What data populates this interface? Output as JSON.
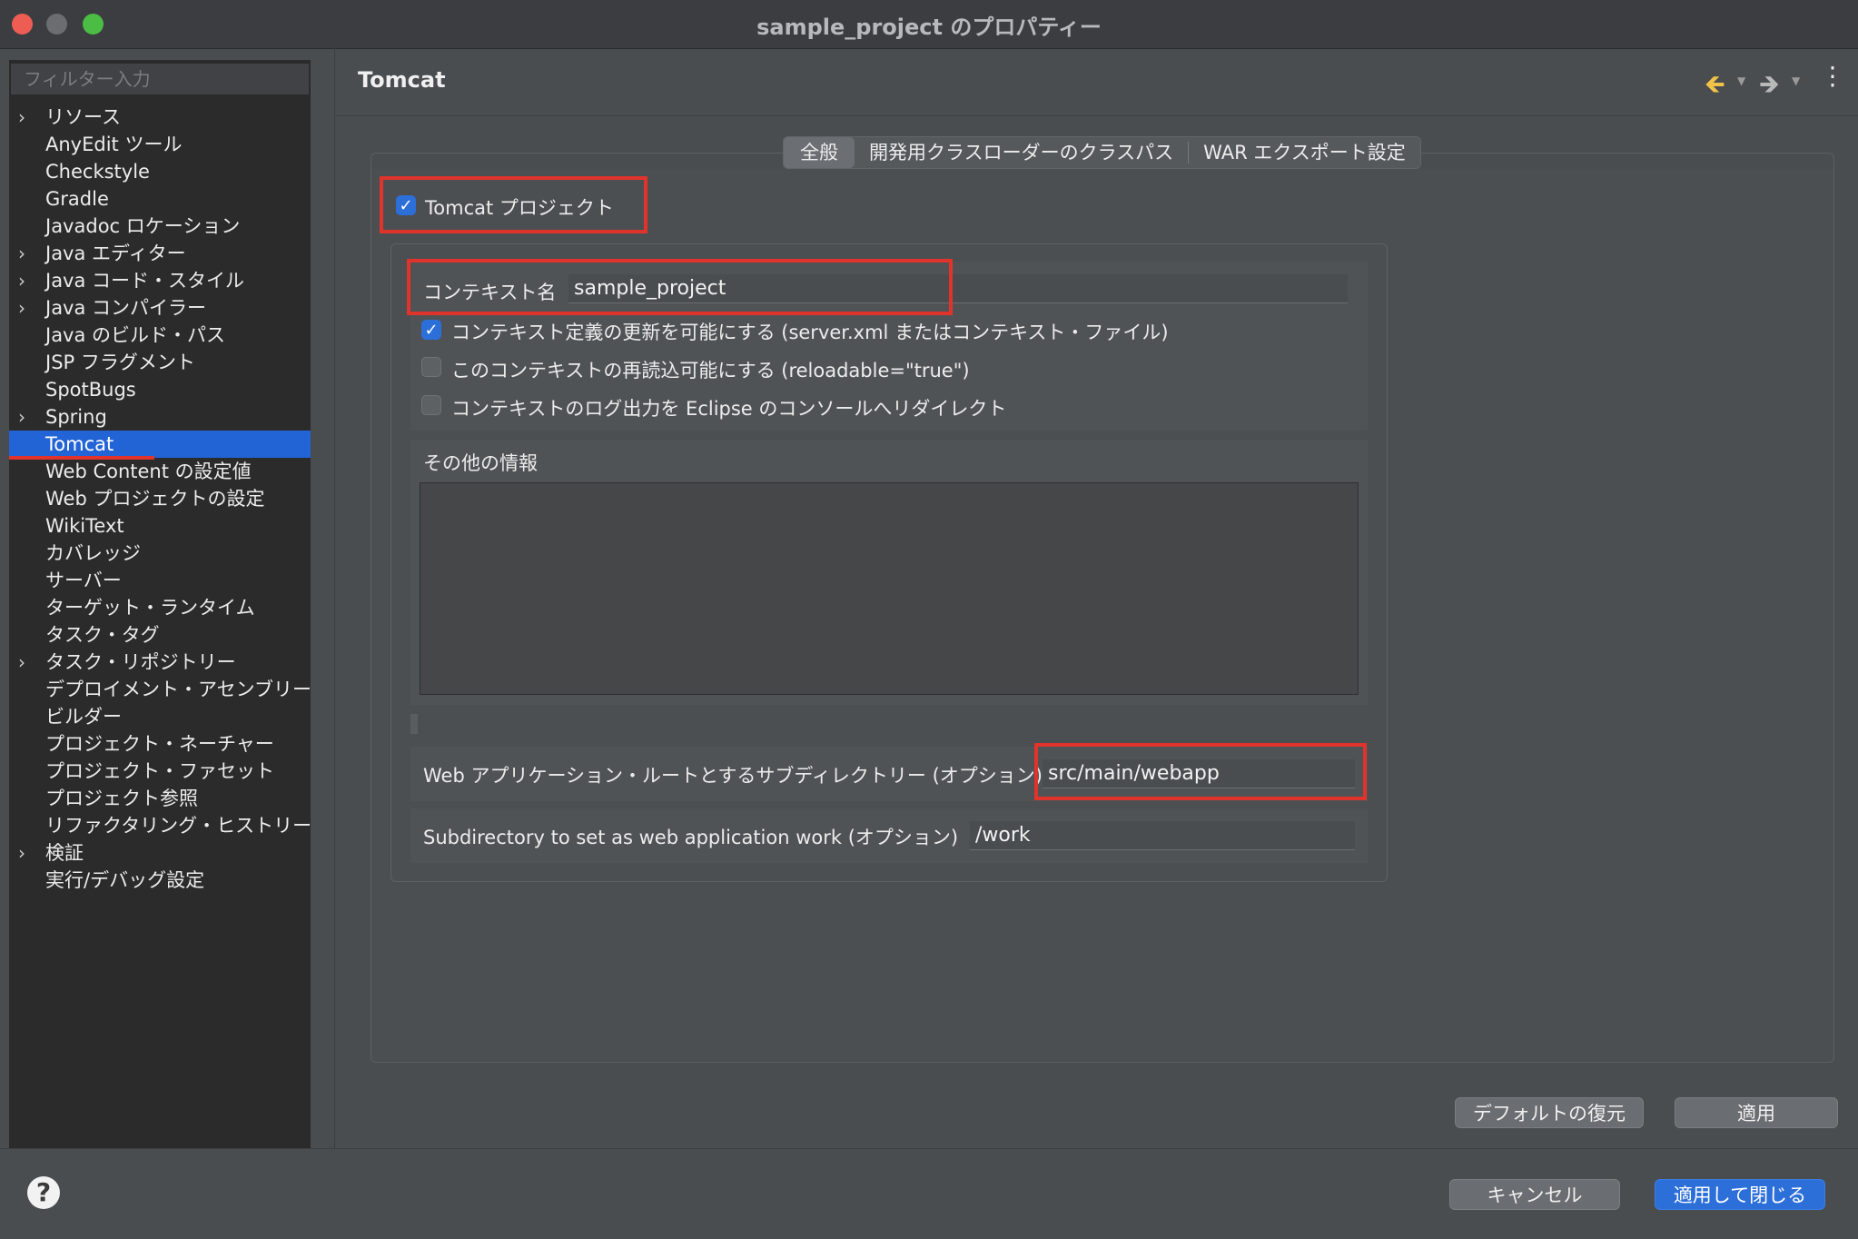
{
  "window": {
    "title": "sample_project のプロパティー"
  },
  "sidebar": {
    "filter_placeholder": "フィルター入力",
    "items": [
      {
        "label": "リソース",
        "expandable": true
      },
      {
        "label": "AnyEdit ツール",
        "expandable": false
      },
      {
        "label": "Checkstyle",
        "expandable": false
      },
      {
        "label": "Gradle",
        "expandable": false
      },
      {
        "label": "Javadoc ロケーション",
        "expandable": false
      },
      {
        "label": "Java エディター",
        "expandable": true
      },
      {
        "label": "Java コード・スタイル",
        "expandable": true
      },
      {
        "label": "Java コンパイラー",
        "expandable": true
      },
      {
        "label": "Java のビルド・パス",
        "expandable": false
      },
      {
        "label": "JSP フラグメント",
        "expandable": false
      },
      {
        "label": "SpotBugs",
        "expandable": false
      },
      {
        "label": "Spring",
        "expandable": true
      },
      {
        "label": "Tomcat",
        "expandable": false,
        "selected": true
      },
      {
        "label": "Web Content の設定値",
        "expandable": false
      },
      {
        "label": "Web プロジェクトの設定",
        "expandable": false
      },
      {
        "label": "WikiText",
        "expandable": false
      },
      {
        "label": "カバレッジ",
        "expandable": false
      },
      {
        "label": "サーバー",
        "expandable": false
      },
      {
        "label": "ターゲット・ランタイム",
        "expandable": false
      },
      {
        "label": "タスク・タグ",
        "expandable": false
      },
      {
        "label": "タスク・リポジトリー",
        "expandable": true
      },
      {
        "label": "デプロイメント・アセンブリー",
        "expandable": false
      },
      {
        "label": "ビルダー",
        "expandable": false
      },
      {
        "label": "プロジェクト・ネーチャー",
        "expandable": false
      },
      {
        "label": "プロジェクト・ファセット",
        "expandable": false
      },
      {
        "label": "プロジェクト参照",
        "expandable": false
      },
      {
        "label": "リファクタリング・ヒストリー",
        "expandable": false
      },
      {
        "label": "検証",
        "expandable": true
      },
      {
        "label": "実行/デバッグ設定",
        "expandable": false
      }
    ]
  },
  "page": {
    "title": "Tomcat"
  },
  "tabs": [
    {
      "label": "全般",
      "active": true
    },
    {
      "label": "開発用クラスローダーのクラスパス",
      "active": false
    },
    {
      "label": "WAR エクスポート設定",
      "active": false
    }
  ],
  "general": {
    "tomcat_project_label": "Tomcat プロジェクト",
    "tomcat_project_checked": true,
    "context_name_label": "コンテキスト名",
    "context_name_value": "sample_project",
    "options": [
      {
        "label": "コンテキスト定義の更新を可能にする (server.xml またはコンテキスト・ファイル)",
        "checked": true
      },
      {
        "label": "このコンテキストの再読込可能にする (reloadable=\"true\")",
        "checked": false
      },
      {
        "label": "コンテキストのログ出力を Eclipse のコンソールへリダイレクト",
        "checked": false
      }
    ],
    "other_info_label": "その他の情報",
    "other_info_value": "",
    "webapp_root_label": "Web アプリケーション・ルートとするサブディレクトリー (オプション)",
    "webapp_root_value": "src/main/webapp",
    "work_dir_label": "Subdirectory to set as web application work (オプション)",
    "work_dir_value": "/work"
  },
  "buttons": {
    "restore_defaults": "デフォルトの復元",
    "apply": "適用",
    "cancel": "キャンセル",
    "apply_and_close": "適用して閉じる"
  },
  "icons": {
    "back": "arrow-left-icon",
    "forward": "arrow-right-icon",
    "menu": "vertical-dots-icon",
    "help": "help-icon"
  },
  "colors": {
    "accent": "#2c6fd9",
    "highlight": "#e0332b",
    "back_arrow": "#f0c24a"
  }
}
